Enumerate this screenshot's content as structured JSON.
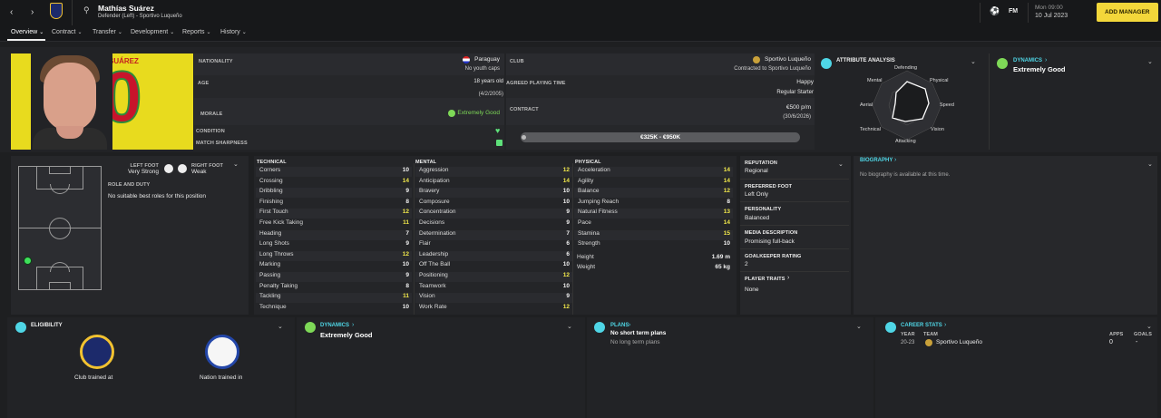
{
  "player": {
    "name": "Mathías Suárez",
    "subtitle": "Defender (Left) - Sportivo Luqueño",
    "shirt_name": "SUÁREZ",
    "shirt_number": "0"
  },
  "topbar": {
    "fm_label": "FM",
    "date_day": "Mon 09:00",
    "date": "10 Jul 2023",
    "add_manager": "ADD MANAGER"
  },
  "nav": {
    "tabs": [
      {
        "label": "Overview"
      },
      {
        "label": "Contract"
      },
      {
        "label": "Transfer"
      },
      {
        "label": "Development"
      },
      {
        "label": "Reports"
      },
      {
        "label": "History"
      }
    ]
  },
  "info": {
    "nationality_label": "NATIONALITY",
    "nationality": "Paraguay",
    "youth_caps": "No youth caps",
    "age_label": "AGE",
    "age": "18 years old",
    "dob": "(4/2/2005)",
    "morale_label": "MORALE",
    "morale": "Extremely Good",
    "condition_label": "CONDITION",
    "sharpness_label": "MATCH SHARPNESS",
    "club_label": "CLUB",
    "club": "Sportivo Luqueño",
    "contracted_to": "Contracted to Sportivo Luqueño",
    "apt_label": "AGREED PLAYING TIME",
    "apt_mood": "Happy",
    "apt": "Regular Starter",
    "contract_label": "CONTRACT",
    "wage": "€500 p/m",
    "contract_end": "(30/6/2026)",
    "value": "€325K - €950K"
  },
  "attr_analysis": {
    "title": "ATTRIBUTE ANALYSIS",
    "labels": [
      "Defending",
      "Physical",
      "Speed",
      "Vision",
      "Attacking",
      "Technical",
      "Aerial",
      "Mental"
    ]
  },
  "dynamics": {
    "title": "DYNAMICS",
    "value": "Extremely Good"
  },
  "feet": {
    "left_label": "LEFT FOOT",
    "left_value": "Very Strong",
    "right_label": "RIGHT FOOT",
    "right_value": "Weak"
  },
  "role": {
    "title": "ROLE AND DUTY",
    "text": "No suitable best roles for this position"
  },
  "technical": {
    "title": "TECHNICAL",
    "rows": [
      {
        "name": "Corners",
        "value": "10"
      },
      {
        "name": "Crossing",
        "value": "14"
      },
      {
        "name": "Dribbling",
        "value": "9"
      },
      {
        "name": "Finishing",
        "value": "8"
      },
      {
        "name": "First Touch",
        "value": "12"
      },
      {
        "name": "Free Kick Taking",
        "value": "11"
      },
      {
        "name": "Heading",
        "value": "7"
      },
      {
        "name": "Long Shots",
        "value": "9"
      },
      {
        "name": "Long Throws",
        "value": "12"
      },
      {
        "name": "Marking",
        "value": "10"
      },
      {
        "name": "Passing",
        "value": "9"
      },
      {
        "name": "Penalty Taking",
        "value": "8"
      },
      {
        "name": "Tackling",
        "value": "11"
      },
      {
        "name": "Technique",
        "value": "10"
      }
    ]
  },
  "mental": {
    "title": "MENTAL",
    "rows": [
      {
        "name": "Aggression",
        "value": "12"
      },
      {
        "name": "Anticipation",
        "value": "14"
      },
      {
        "name": "Bravery",
        "value": "10"
      },
      {
        "name": "Composure",
        "value": "10"
      },
      {
        "name": "Concentration",
        "value": "9"
      },
      {
        "name": "Decisions",
        "value": "9"
      },
      {
        "name": "Determination",
        "value": "7"
      },
      {
        "name": "Flair",
        "value": "6"
      },
      {
        "name": "Leadership",
        "value": "6"
      },
      {
        "name": "Off The Ball",
        "value": "10"
      },
      {
        "name": "Positioning",
        "value": "12"
      },
      {
        "name": "Teamwork",
        "value": "10"
      },
      {
        "name": "Vision",
        "value": "9"
      },
      {
        "name": "Work Rate",
        "value": "12"
      }
    ]
  },
  "physical": {
    "title": "PHYSICAL",
    "rows": [
      {
        "name": "Acceleration",
        "value": "14"
      },
      {
        "name": "Agility",
        "value": "14"
      },
      {
        "name": "Balance",
        "value": "12"
      },
      {
        "name": "Jumping Reach",
        "value": "8"
      },
      {
        "name": "Natural Fitness",
        "value": "13"
      },
      {
        "name": "Pace",
        "value": "14"
      },
      {
        "name": "Stamina",
        "value": "15"
      },
      {
        "name": "Strength",
        "value": "10"
      }
    ],
    "height_label": "Height",
    "height": "1.69 m",
    "weight_label": "Weight",
    "weight": "65 kg"
  },
  "side": {
    "reputation_label": "REPUTATION",
    "reputation": "Regional",
    "pref_foot_label": "PREFERRED FOOT",
    "pref_foot": "Left Only",
    "personality_label": "PERSONALITY",
    "personality": "Balanced",
    "media_label": "MEDIA DESCRIPTION",
    "media": "Promising full-back",
    "gk_label": "GOALKEEPER RATING",
    "gk": "2",
    "traits_label": "PLAYER TRAITS",
    "traits": "None"
  },
  "biography": {
    "title": "BIOGRAPHY",
    "text": "No biography is available at this time."
  },
  "eligibility": {
    "title": "ELIGIBILITY",
    "club_trained": "Club trained at",
    "nation_trained": "Nation trained in"
  },
  "plans": {
    "title": "PLANS",
    "short": "No short term plans",
    "long": "No long term plans"
  },
  "career": {
    "title": "CAREER STATS",
    "year_h": "YEAR",
    "team_h": "TEAM",
    "apps_h": "APPS",
    "goals_h": "GOALS",
    "year": "20-23",
    "team": "Sportivo Luqueño",
    "apps": "0",
    "goals": "-"
  },
  "colors": {
    "accent": "#f3d73a",
    "teal": "#4fd6e6",
    "green": "#7ed957",
    "highlight": "#f1e84a"
  }
}
